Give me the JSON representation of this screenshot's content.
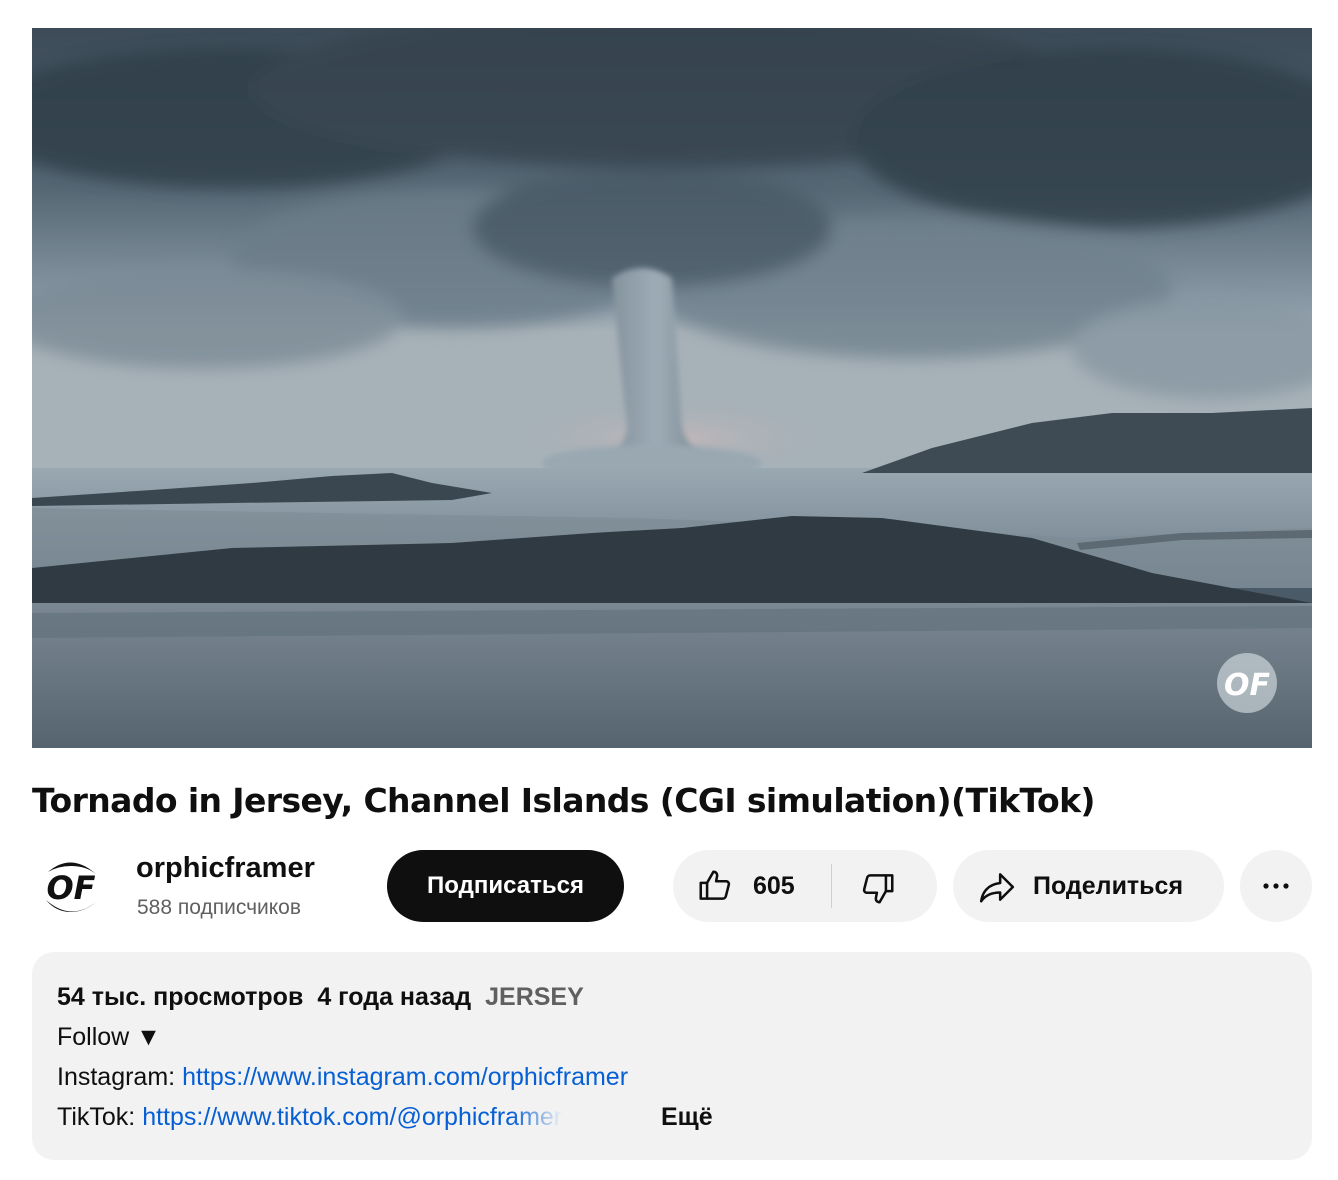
{
  "video": {
    "title": "Tornado in Jersey, Channel Islands (CGI simulation)(TikTok)",
    "watermark": "OF"
  },
  "channel": {
    "name": "orphicframer",
    "subscribers": "588 подписчиков",
    "avatar_text": "OF"
  },
  "actions": {
    "subscribe_label": "Подписаться",
    "like_count": "605",
    "share_label": "Поделиться",
    "like_icon": "thumb-up-icon",
    "dislike_icon": "thumb-down-icon",
    "share_icon": "share-arrow-icon",
    "more_icon": "more-horizontal-icon"
  },
  "description": {
    "views": "54 тыс. просмотров",
    "published": "4 года назад",
    "hashtag": "JERSEY",
    "follow_line": "Follow ▼",
    "instagram_label": "Instagram: ",
    "instagram_url": "https://www.instagram.com/orphicframer",
    "tiktok_label": "TikTok: ",
    "tiktok_url": "https://www.tiktok.com/@orphicframer",
    "more_label": "Ещё"
  },
  "colors": {
    "subscribe_bg": "#0f0f0f",
    "pill_bg": "#f2f2f2",
    "link": "#065fd4",
    "secondary_text": "#606060"
  }
}
